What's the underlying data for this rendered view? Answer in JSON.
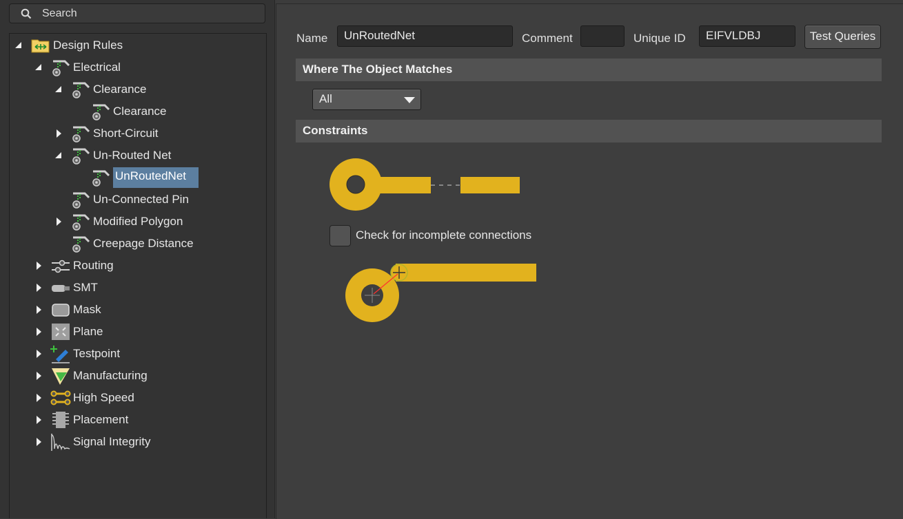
{
  "search": {
    "placeholder": "Search"
  },
  "tree": [
    {
      "label": "Design Rules",
      "depth": 0,
      "expander": "expanded",
      "icon": "design-rules-icon"
    },
    {
      "label": "Electrical",
      "depth": 1,
      "expander": "expanded",
      "icon": "electrical-rule-icon"
    },
    {
      "label": "Clearance",
      "depth": 2,
      "expander": "expanded",
      "icon": "electrical-rule-icon"
    },
    {
      "label": "Clearance",
      "depth": 3,
      "expander": "none",
      "icon": "electrical-rule-icon"
    },
    {
      "label": "Short-Circuit",
      "depth": 2,
      "expander": "collapsed",
      "icon": "electrical-rule-icon"
    },
    {
      "label": "Un-Routed Net",
      "depth": 2,
      "expander": "expanded",
      "icon": "electrical-rule-icon"
    },
    {
      "label": "UnRoutedNet",
      "depth": 3,
      "expander": "none",
      "icon": "electrical-rule-icon",
      "selected": true
    },
    {
      "label": "Un-Connected Pin",
      "depth": 2,
      "expander": "none",
      "icon": "electrical-rule-icon"
    },
    {
      "label": "Modified Polygon",
      "depth": 2,
      "expander": "collapsed",
      "icon": "electrical-rule-icon"
    },
    {
      "label": "Creepage Distance",
      "depth": 2,
      "expander": "none",
      "icon": "electrical-rule-icon"
    },
    {
      "label": "Routing",
      "depth": 1,
      "expander": "collapsed",
      "icon": "routing-icon"
    },
    {
      "label": "SMT",
      "depth": 1,
      "expander": "collapsed",
      "icon": "smt-icon"
    },
    {
      "label": "Mask",
      "depth": 1,
      "expander": "collapsed",
      "icon": "mask-icon"
    },
    {
      "label": "Plane",
      "depth": 1,
      "expander": "collapsed",
      "icon": "plane-icon"
    },
    {
      "label": "Testpoint",
      "depth": 1,
      "expander": "collapsed",
      "icon": "testpoint-icon"
    },
    {
      "label": "Manufacturing",
      "depth": 1,
      "expander": "collapsed",
      "icon": "manufacturing-icon"
    },
    {
      "label": "High Speed",
      "depth": 1,
      "expander": "collapsed",
      "icon": "high-speed-icon"
    },
    {
      "label": "Placement",
      "depth": 1,
      "expander": "collapsed",
      "icon": "placement-icon"
    },
    {
      "label": "Signal Integrity",
      "depth": 1,
      "expander": "collapsed",
      "icon": "signal-integrity-icon"
    }
  ],
  "rule": {
    "name_label": "Name",
    "name_value": "UnRoutedNet",
    "comment_label": "Comment",
    "comment_value": "",
    "unique_id_label": "Unique ID",
    "unique_id_value": "EIFVLDBJ",
    "test_queries_label": "Test Queries"
  },
  "scope": {
    "header": "Where The Object Matches",
    "selected": "All"
  },
  "constraints": {
    "header": "Constraints",
    "checkbox_label": "Check for incomplete connections",
    "checkbox_checked": false
  },
  "colors": {
    "accent_selection": "#5c7fa0",
    "pad_copper": "#e2b21e",
    "rule_icon_green": "#3ec33e"
  }
}
